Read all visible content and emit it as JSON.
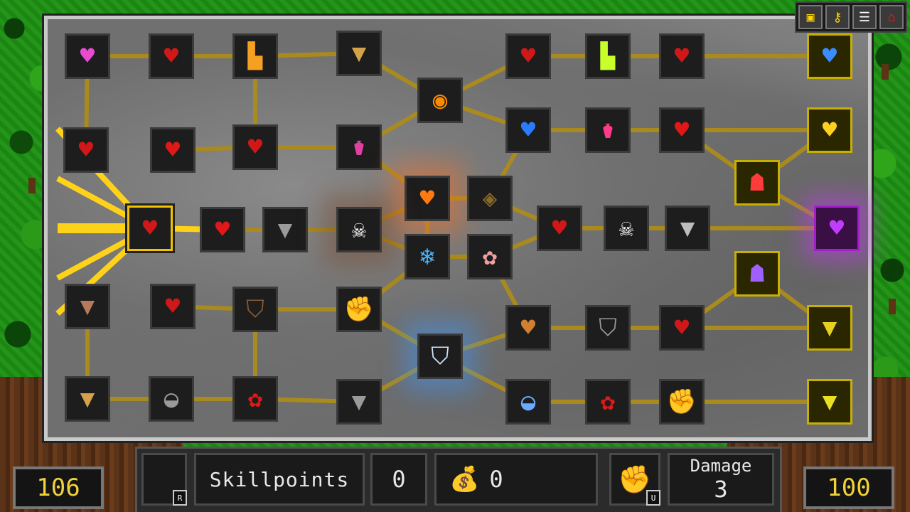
{
  "toolbar": {
    "buttons": [
      {
        "icon": "chip-icon",
        "glyph": "▣"
      },
      {
        "icon": "key-icon",
        "glyph": "⚷"
      },
      {
        "icon": "notes-icon",
        "glyph": "☰"
      },
      {
        "icon": "home-icon",
        "glyph": "⌂"
      }
    ]
  },
  "skill_tree": {
    "nodes": [
      {
        "id": "n1",
        "icon": "heart-health-plus-icon",
        "glyph": "♥",
        "color": "#e84ad0"
      },
      {
        "id": "n2",
        "icon": "small-hearts-icon",
        "glyph": "♥",
        "color": "#d01818"
      },
      {
        "id": "n3",
        "icon": "boot-icon",
        "glyph": "▙",
        "color": "#f5a020"
      },
      {
        "id": "n4",
        "icon": "armor-torso-icon",
        "glyph": "▼",
        "color": "#d4a24a"
      },
      {
        "id": "n5",
        "icon": "black-hole-icon",
        "glyph": "◉",
        "color": "#ff8a00"
      },
      {
        "id": "n6",
        "icon": "heart-plus-icon",
        "glyph": "♥",
        "color": "#d01818"
      },
      {
        "id": "n7",
        "icon": "speed-boot-icon",
        "glyph": "▙",
        "color": "#c8ff2a"
      },
      {
        "id": "n8",
        "icon": "heart-armor-icon",
        "glyph": "♥",
        "color": "#d01818"
      },
      {
        "id": "n9",
        "icon": "blue-heart-plus-icon",
        "glyph": "♥",
        "color": "#3a8cff"
      },
      {
        "id": "n10",
        "icon": "heart-plus-large-icon",
        "glyph": "♥",
        "color": "#d01818"
      },
      {
        "id": "n11",
        "icon": "anatomical-heart-icon",
        "glyph": "♥",
        "color": "#e01818"
      },
      {
        "id": "n12",
        "icon": "hearts-plus-icon",
        "glyph": "♥",
        "color": "#d01818"
      },
      {
        "id": "n13",
        "icon": "potion-icon",
        "glyph": "⚱",
        "color": "#e040a0"
      },
      {
        "id": "n14",
        "icon": "heart-blue-plus-icon",
        "glyph": "♥",
        "color": "#2a7cff"
      },
      {
        "id": "n15",
        "icon": "green-potion-icon",
        "glyph": "⚱",
        "color": "#ff3a8a"
      },
      {
        "id": "n16",
        "icon": "heart-icon",
        "glyph": "♥",
        "color": "#e01818"
      },
      {
        "id": "n17",
        "icon": "gold-heart-icon",
        "glyph": "♥",
        "color": "#ffd020"
      },
      {
        "id": "n18",
        "icon": "fire-heart-icon",
        "glyph": "♥",
        "color": "#ff7a10"
      },
      {
        "id": "n19",
        "icon": "compass-icon",
        "glyph": "◈",
        "color": "#8a6a2a"
      },
      {
        "id": "n20",
        "icon": "red-figure-icon",
        "glyph": "☗",
        "color": "#ff3a3a"
      },
      {
        "id": "n21",
        "icon": "heart-armor-selected-icon",
        "glyph": "♥",
        "color": "#d01818"
      },
      {
        "id": "n22",
        "icon": "heart-icon",
        "glyph": "♥",
        "color": "#e01818"
      },
      {
        "id": "n23",
        "icon": "grey-armor-icon",
        "glyph": "▼",
        "color": "#9a9a9a"
      },
      {
        "id": "n24",
        "icon": "skeleton-icon",
        "glyph": "☠",
        "color": "#ffffff"
      },
      {
        "id": "n25",
        "icon": "heart-plus-armor-icon",
        "glyph": "♥",
        "color": "#d01818"
      },
      {
        "id": "n26",
        "icon": "skull-icon",
        "glyph": "☠",
        "color": "#ffffff"
      },
      {
        "id": "n27",
        "icon": "shining-armor-icon",
        "glyph": "▼",
        "color": "#bdbdbd"
      },
      {
        "id": "n28",
        "icon": "purple-heart-icon",
        "glyph": "♥",
        "color": "#c23cff"
      },
      {
        "id": "n29",
        "icon": "ice-shard-icon",
        "glyph": "❄",
        "color": "#4ab4ff"
      },
      {
        "id": "n30",
        "icon": "brain-icon",
        "glyph": "✿",
        "color": "#f0a0a0"
      },
      {
        "id": "n31",
        "icon": "blue-figure-icon",
        "glyph": "☗",
        "color": "#a060ff"
      },
      {
        "id": "n32",
        "icon": "muscle-torso-icon",
        "glyph": "▼",
        "color": "#b87a5a"
      },
      {
        "id": "n33",
        "icon": "heart-armor-icon",
        "glyph": "♥",
        "color": "#d01818"
      },
      {
        "id": "n34",
        "icon": "wooden-shield-icon",
        "glyph": "⛉",
        "color": "#8a5a34"
      },
      {
        "id": "n35",
        "icon": "fist-icon",
        "glyph": "✊",
        "color": "#f5c8a0"
      },
      {
        "id": "n36",
        "icon": "bread-heart-icon",
        "glyph": "♥",
        "color": "#d08030"
      },
      {
        "id": "n37",
        "icon": "steel-shield-icon",
        "glyph": "⛉",
        "color": "#9a9a9a"
      },
      {
        "id": "n38",
        "icon": "heart-armor-icon",
        "glyph": "♥",
        "color": "#d01818"
      },
      {
        "id": "n39",
        "icon": "gold-armor-icon",
        "glyph": "▼",
        "color": "#e8d020"
      },
      {
        "id": "n40",
        "icon": "frost-shield-icon",
        "glyph": "⛉",
        "color": "#cfe6ff"
      },
      {
        "id": "n41",
        "icon": "sparkle-armor-icon",
        "glyph": "▼",
        "color": "#d4a24a"
      },
      {
        "id": "n42",
        "icon": "helmet-icon",
        "glyph": "◒",
        "color": "#9a9a9a"
      },
      {
        "id": "n43",
        "icon": "rose-icon",
        "glyph": "✿",
        "color": "#e01818"
      },
      {
        "id": "n44",
        "icon": "chest-armor-icon",
        "glyph": "▼",
        "color": "#9a9a9a"
      },
      {
        "id": "n45",
        "icon": "blue-helmet-icon",
        "glyph": "◒",
        "color": "#6aaaff"
      },
      {
        "id": "n46",
        "icon": "rose-icon",
        "glyph": "✿",
        "color": "#e01818"
      },
      {
        "id": "n47",
        "icon": "glowing-fist-icon",
        "glyph": "✊",
        "color": "#f5c0b0"
      },
      {
        "id": "n48",
        "icon": "gold-plate-icon",
        "glyph": "▼",
        "color": "#e8e020"
      }
    ]
  },
  "hud": {
    "skill_slot_key": "R",
    "skillpoints_label": "Skillpoints",
    "skillpoints_value": "0",
    "money_icon": "money-bag-icon",
    "money_value": "0",
    "weapon_icon": "fist-icon",
    "weapon_key": "U",
    "damage_label": "Damage",
    "damage_value": "3",
    "left_counter": "106",
    "right_counter": "100"
  }
}
